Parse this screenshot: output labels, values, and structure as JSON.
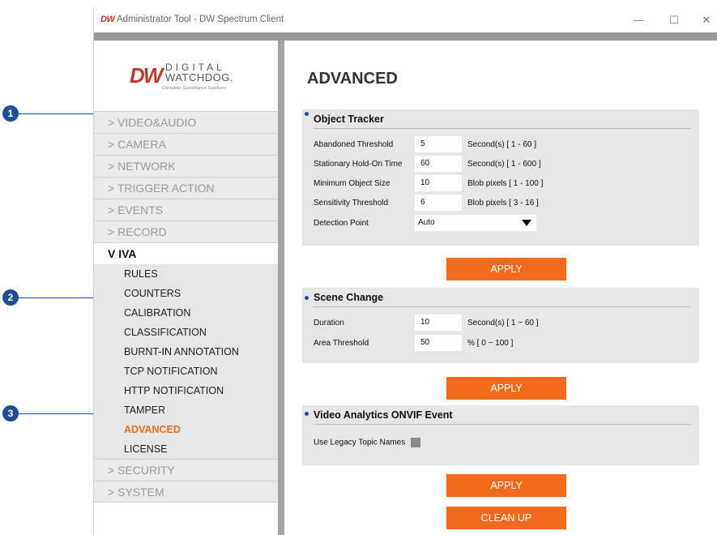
{
  "window": {
    "logo": "DW",
    "title": "Administrator Tool - DW Spectrum Client"
  },
  "brand": {
    "mark": "DW",
    "line1": "DIGITAL",
    "line2": "WATCHDOG.",
    "tagline": "Complete Surveillance Solutions"
  },
  "sidebar": {
    "items": [
      {
        "label": "> VIDEO&AUDIO"
      },
      {
        "label": "> CAMERA"
      },
      {
        "label": "> NETWORK"
      },
      {
        "label": "> TRIGGER ACTION"
      },
      {
        "label": "> EVENTS"
      },
      {
        "label": "> RECORD"
      },
      {
        "label": "V IVA"
      }
    ],
    "iva_subitems": [
      {
        "label": "RULES"
      },
      {
        "label": "COUNTERS"
      },
      {
        "label": "CALIBRATION"
      },
      {
        "label": "CLASSIFICATION"
      },
      {
        "label": "BURNT-IN ANNOTATION"
      },
      {
        "label": "TCP NOTIFICATION"
      },
      {
        "label": "HTTP NOTIFICATION"
      },
      {
        "label": "TAMPER"
      },
      {
        "label": "ADVANCED"
      },
      {
        "label": "LICENSE"
      }
    ],
    "bottom_items": [
      {
        "label": "> SECURITY"
      },
      {
        "label": "> SYSTEM"
      }
    ]
  },
  "main": {
    "title": "ADVANCED",
    "object_tracker": {
      "title": "Object Tracker",
      "rows": [
        {
          "label": "Abandoned Threshold",
          "value": "5",
          "unit": "Second(s) [ 1 - 60 ]"
        },
        {
          "label": "Stationary Hold-On Time",
          "value": "60",
          "unit": "Second(s) [ 1 - 600 ]"
        },
        {
          "label": "Minimum Object Size",
          "value": "10",
          "unit": "Blob pixels [ 1 - 100 ]"
        },
        {
          "label": "Sensitivity Threshold",
          "value": "6",
          "unit": "Blob pixels [ 3 - 16 ]"
        }
      ],
      "detection_label": "Detection Point",
      "detection_value": "Auto",
      "apply": "APPLY"
    },
    "scene_change": {
      "title": "Scene Change",
      "rows": [
        {
          "label": "Duration",
          "value": "10",
          "unit": "Second(s) [ 1 ~ 60 ]"
        },
        {
          "label": "Area Threshold",
          "value": "50",
          "unit": "% [ 0 ~ 100 ]"
        }
      ],
      "apply": "APPLY"
    },
    "onvif": {
      "title": "Video Analytics ONVIF Event",
      "legacy_label": "Use Legacy Topic Names",
      "apply": "APPLY",
      "cleanup": "CLEAN UP"
    }
  },
  "callouts": [
    "1",
    "2",
    "3"
  ],
  "colors": {
    "accent": "#f26a1b",
    "callout": "#1f4f93",
    "brand": "#c0392b"
  }
}
